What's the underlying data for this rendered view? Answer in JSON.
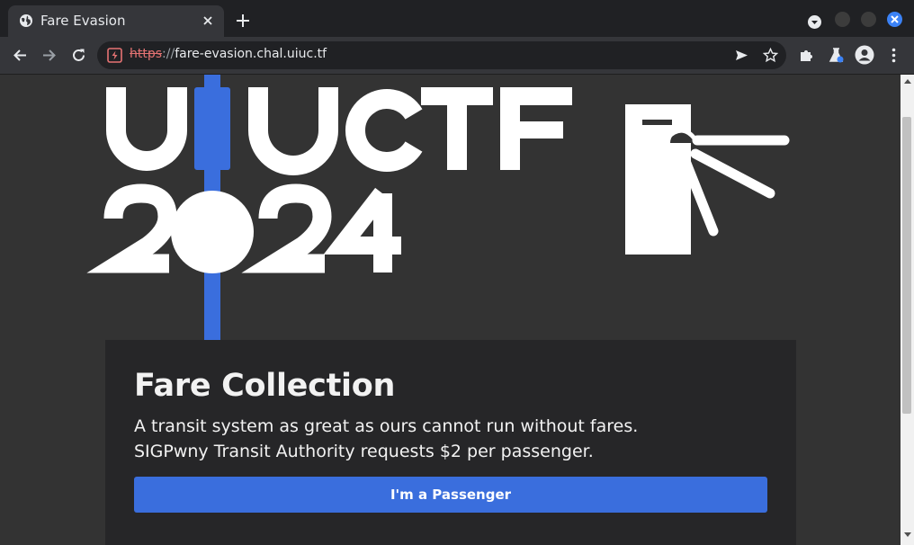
{
  "browser": {
    "tab": {
      "title": "Fare Evasion"
    },
    "address": {
      "scheme": "https",
      "separator": "://",
      "host": "fare-evasion.chal.uiuc.tf"
    }
  },
  "page": {
    "logo": {
      "top_text": "U  UCTF",
      "year": "2024"
    },
    "card": {
      "title": "Fare Collection",
      "text": "A transit system as great as ours cannot run without fares. SIGPwny Transit Authority requests $2 per passenger.",
      "button_label": "I'm a Passenger"
    }
  },
  "colors": {
    "accent": "#3a6edd",
    "background": "#333333",
    "card": "#262628"
  },
  "icons": [
    "globe-icon",
    "close-icon",
    "plus-icon",
    "back-icon",
    "forward-icon",
    "reload-icon",
    "not-secure-icon",
    "send-icon",
    "star-icon",
    "puzzle-icon",
    "labs-icon",
    "profile-icon",
    "kebab-menu-icon"
  ]
}
